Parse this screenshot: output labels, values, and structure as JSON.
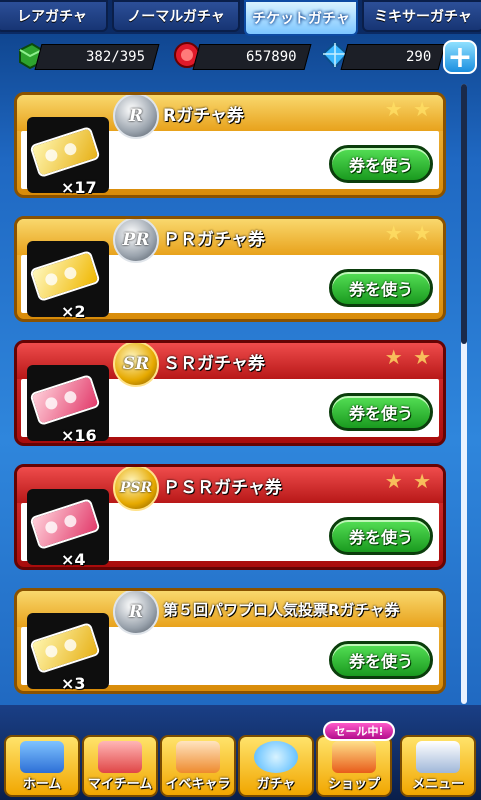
{
  "tabs": [
    {
      "label": "レアガチャ",
      "active": false
    },
    {
      "label": "ノーマルガチャ",
      "active": false
    },
    {
      "label": "チケットガチャ",
      "active": true
    },
    {
      "label": "ミキサーガチャ",
      "active": false
    }
  ],
  "resources": {
    "stamina": "382/395",
    "coins": "657890",
    "gems": "290"
  },
  "icons": {
    "stamina": "green-battery-icon",
    "coins": "red-coin-icon",
    "gems": "blue-diamond-icon",
    "plus": "plus-icon"
  },
  "tickets": [
    {
      "name": "Rガチャ券",
      "count": "×17",
      "rarity": "R",
      "button": "券を使う"
    },
    {
      "name": "ＰＲガチャ券",
      "count": "×2",
      "rarity": "PR",
      "button": "券を使う"
    },
    {
      "name": "ＳＲガチャ券",
      "count": "×16",
      "rarity": "SR",
      "button": "券を使う"
    },
    {
      "name": "ＰＳＲガチャ券",
      "count": "×4",
      "rarity": "PSR",
      "button": "券を使う"
    },
    {
      "name": "第５回パワプロ人気投票Rガチャ券",
      "count": "×3",
      "rarity": "R",
      "button": "券を使う"
    }
  ],
  "bottom_nav": [
    {
      "label": "ホーム"
    },
    {
      "label": "マイチーム"
    },
    {
      "label": "イベキャラ"
    },
    {
      "label": "ガチャ"
    },
    {
      "label": "ショップ"
    },
    {
      "label": "メニュー"
    }
  ],
  "sale_badge": "セール中!",
  "colors": {
    "gold_card": "#e8a21c",
    "red_card": "#b81818",
    "use_button": "#1a9a1f",
    "background": "#1f68c2"
  }
}
